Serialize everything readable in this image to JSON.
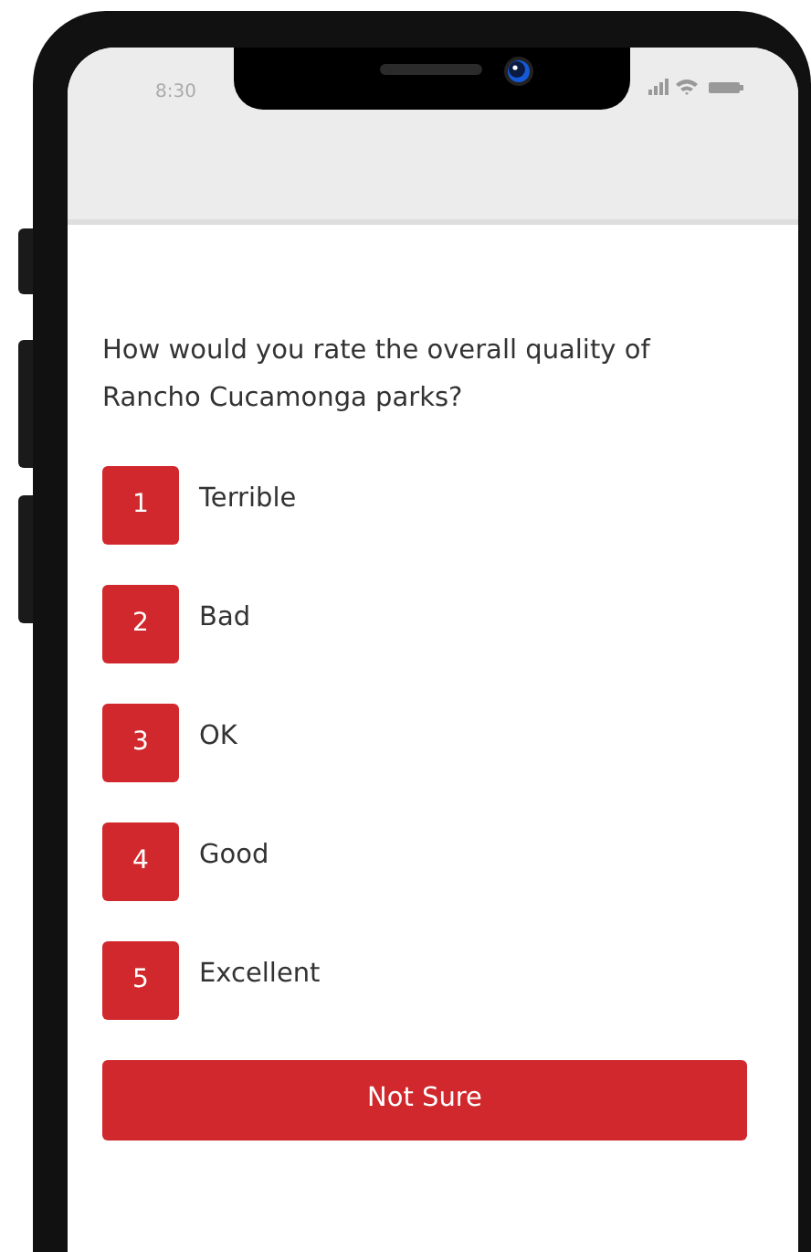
{
  "status_bar": {
    "time": "8:30"
  },
  "question": "How would you rate the overall quality of Rancho Cucamonga parks?",
  "options": [
    {
      "number": "1",
      "label": "Terrible"
    },
    {
      "number": "2",
      "label": "Bad"
    },
    {
      "number": "3",
      "label": "OK"
    },
    {
      "number": "4",
      "label": "Good"
    },
    {
      "number": "5",
      "label": "Excellent"
    }
  ],
  "not_sure_button": "Not Sure"
}
